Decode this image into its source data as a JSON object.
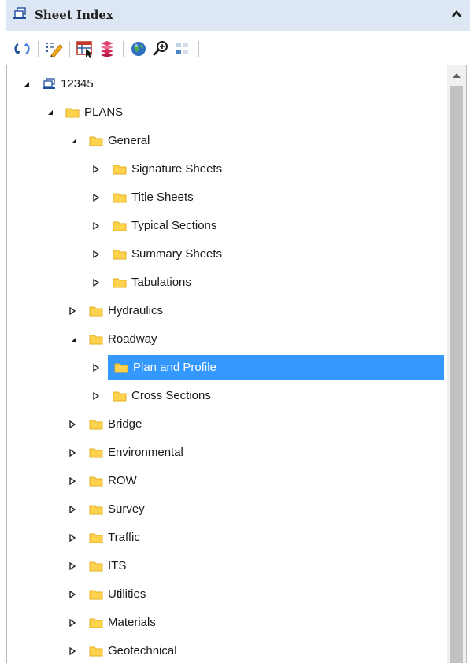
{
  "panel": {
    "title": "Sheet Index",
    "title_icon": "sheet-index-icon",
    "collapse_icon": "chevron-up-icon"
  },
  "toolbar": {
    "buttons": [
      {
        "icon": "refresh-icon"
      },
      {
        "icon": "edit-properties-icon"
      },
      {
        "icon": "select-sheets-icon"
      },
      {
        "icon": "arrange-sheets-icon"
      },
      {
        "icon": "publish-globe-icon"
      },
      {
        "icon": "zoom-search-icon"
      },
      {
        "icon": "grid-view-icon"
      }
    ]
  },
  "tree": {
    "root": "12345",
    "plans": "PLANS",
    "general": "General",
    "general_children": [
      "Signature Sheets",
      "Title Sheets",
      "Typical Sections",
      "Summary Sheets",
      "Tabulations"
    ],
    "hydraulics": "Hydraulics",
    "roadway": "Roadway",
    "roadway_children": [
      "Plan and Profile",
      "Cross Sections"
    ],
    "disciplines": [
      "Bridge",
      "Environmental",
      "ROW",
      "Survey",
      "Traffic",
      "ITS",
      "Utilities",
      "Materials",
      "Geotechnical"
    ],
    "selected": "Plan and Profile"
  },
  "colors": {
    "titlebar_bg": "#dde7f4",
    "selection": "#3399ff",
    "folder": "#ffd24d",
    "folder_edge": "#e0b020"
  }
}
